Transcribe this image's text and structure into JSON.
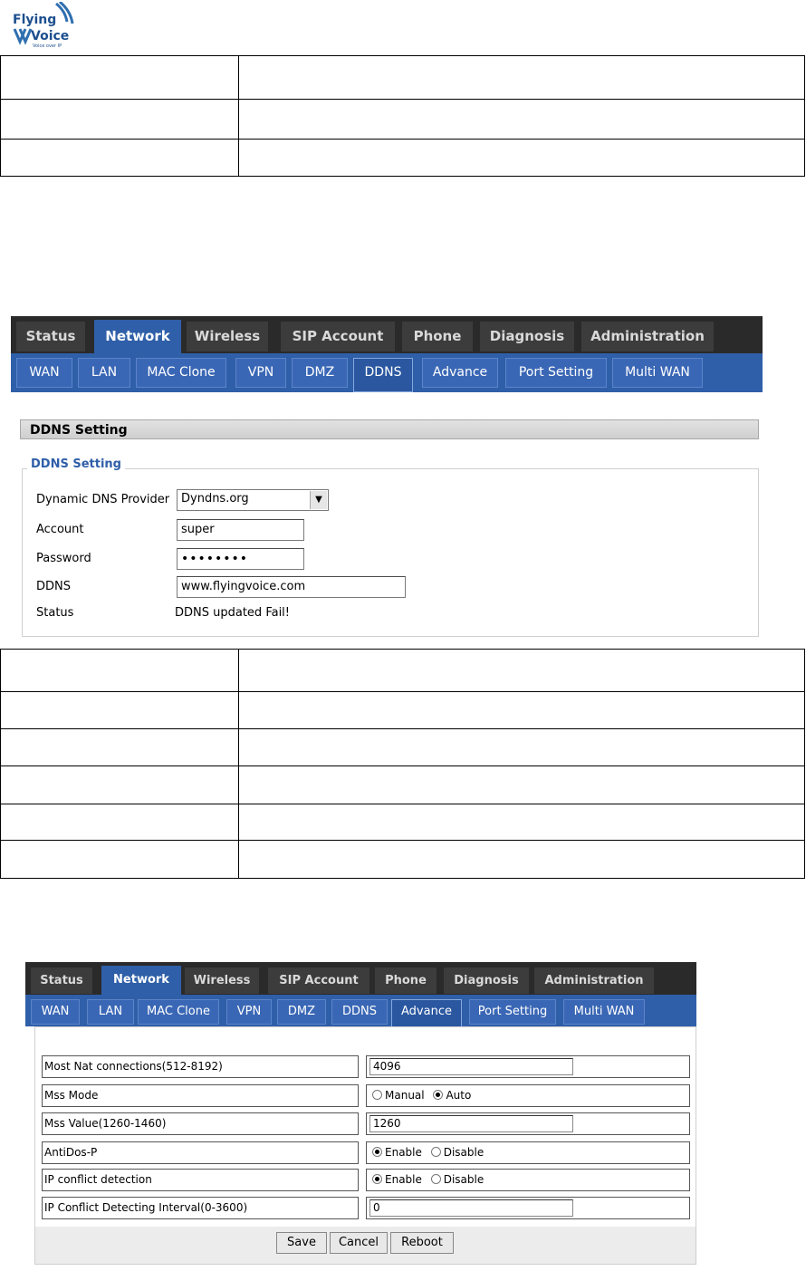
{
  "logo": {
    "line1": "Flying",
    "line2": "Voice",
    "tagline": "Voice over IP"
  },
  "nav_tabs": [
    "Status",
    "Network",
    "Wireless",
    "SIP Account",
    "Phone",
    "Diagnosis",
    "Administration"
  ],
  "active_tab": "Network",
  "sub_tabs": [
    "WAN",
    "LAN",
    "MAC Clone",
    "VPN",
    "DMZ",
    "DDNS",
    "Advance",
    "Port Setting",
    "Multi WAN"
  ],
  "ddns": {
    "header": "DDNS Setting",
    "legend": "DDNS Setting",
    "provider_label": "Dynamic DNS Provider",
    "provider_value": "Dyndns.org",
    "account_label": "Account",
    "account_value": "super",
    "password_label": "Password",
    "password_value": "••••••••",
    "ddns_label": "DDNS",
    "ddns_value": "www.flyingvoice.com",
    "status_label": "Status",
    "status_value": "DDNS updated Fail!"
  },
  "advance": {
    "rows": [
      {
        "label": "Most Nat connections(512-8192)",
        "value": "4096"
      },
      {
        "label": "Mss Mode",
        "opt1": "Manual",
        "opt2": "Auto"
      },
      {
        "label": "Mss Value(1260-1460)",
        "value": "1260"
      },
      {
        "label": "AntiDos-P",
        "opt1": "Enable",
        "opt2": "Disable"
      },
      {
        "label": "IP conflict detection",
        "opt1": "Enable",
        "opt2": "Disable"
      },
      {
        "label": "IP Conflict Detecting Interval(0-3600)",
        "value": "0"
      }
    ],
    "buttons": {
      "save": "Save",
      "cancel": "Cancel",
      "reboot": "Reboot"
    }
  }
}
